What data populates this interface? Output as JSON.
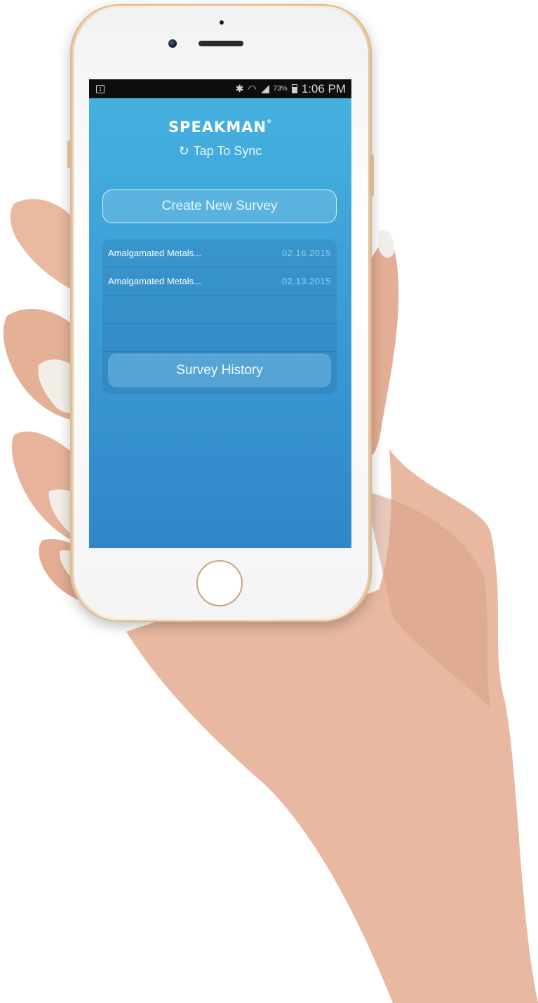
{
  "status_bar": {
    "notification_badge": "1",
    "battery_percent": "73%",
    "time": "1:06 PM",
    "icons": [
      "bluetooth-icon",
      "wifi-icon",
      "signal-icon",
      "battery-icon"
    ]
  },
  "app": {
    "brand": "SPEAKMAN",
    "brand_mark": "®",
    "sync_label": "Tap To Sync",
    "create_button_label": "Create New Survey",
    "surveys": [
      {
        "name": "Amalgamated Metals...",
        "date": "02.16.2015"
      },
      {
        "name": "Amalgamated Metals...",
        "date": "02.13.2015"
      },
      {
        "name": "",
        "date": ""
      },
      {
        "name": "",
        "date": ""
      }
    ],
    "history_button_label": "Survey History"
  },
  "colors": {
    "screen_top": "#46b3e0",
    "screen_bottom": "#3086c8",
    "accent_date": "#8fd0f2",
    "phone_gold": "#e7cba5"
  }
}
